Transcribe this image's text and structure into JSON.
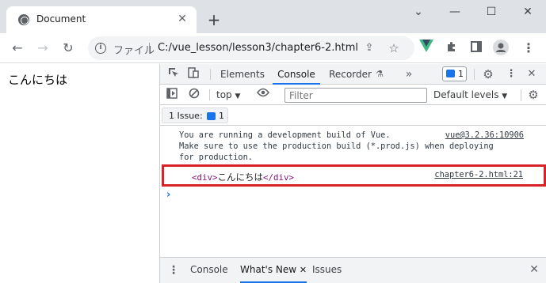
{
  "browser": {
    "tab_title": "Document",
    "new_tab": "+",
    "window_controls": {
      "chevron": "⌄",
      "minimize": "—",
      "maximize": "☐",
      "close": "✕"
    },
    "omnibox": {
      "scheme_label": "ファイル",
      "url": "C:/vue_lesson/lesson3/chapter6-2.html"
    },
    "toolbar_icons": [
      "back-icon",
      "forward-icon",
      "reload-icon",
      "info-icon",
      "share-icon",
      "star-icon",
      "vue-devtools-icon",
      "extensions-icon",
      "side-panel-icon",
      "profile-icon",
      "menu-icon"
    ]
  },
  "page": {
    "text": "こんにちは"
  },
  "devtools": {
    "tabs": [
      "Elements",
      "Console",
      "Recorder"
    ],
    "active_tab": "Console",
    "messages_badge_count": "1",
    "context": "top",
    "filter_placeholder": "Filter",
    "levels": "Default levels",
    "issues": {
      "label": "1 Issue:",
      "count": "1"
    },
    "console": {
      "messages": [
        {
          "text": "You are running a development build of Vue.\nMake sure to use the production build (*.prod.js) when deploying\nfor production.",
          "source": "vue@3.2.36:10906"
        },
        {
          "open_tag": "<div>",
          "content": "こんにちは",
          "close_tag": "</div>",
          "source": "chapter6-2.html:21",
          "highlighted": true,
          "highlight_color": "#d7222a"
        }
      ],
      "prompt": "›"
    },
    "drawer": {
      "tabs": [
        "Console",
        "What's New",
        "Issues"
      ],
      "active_tab": "What's New",
      "close_glyph": "✕"
    }
  }
}
